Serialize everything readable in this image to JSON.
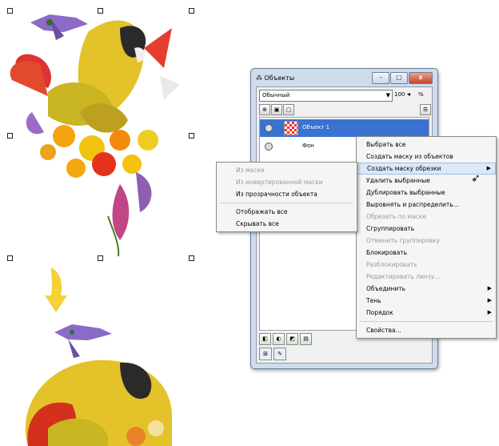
{
  "window": {
    "title": "Объекты",
    "controls": [
      "–",
      "□",
      "x"
    ],
    "blend_mode": "Обычный",
    "opacity": "100",
    "opacity_unit": "%",
    "layers": [
      {
        "label": "Объект 1",
        "selected": true
      },
      {
        "label": "Фон",
        "selected": false
      }
    ]
  },
  "context_menu": {
    "items": [
      {
        "label": "Выбрать все",
        "enabled": true
      },
      {
        "label": "Создать маску из объектов",
        "enabled": true
      },
      {
        "label": "Создать маску обрезки",
        "enabled": true,
        "submenu": true,
        "highlighted": true
      },
      {
        "label": "Удалить выбранные",
        "enabled": true
      },
      {
        "label": "Дублировать выбранные",
        "enabled": true
      },
      {
        "label": "Выровнять и распределить...",
        "enabled": true
      },
      {
        "label": "Обрезать по маске",
        "enabled": false
      },
      {
        "label": "Сгруппировать",
        "enabled": true
      },
      {
        "label": "Отменить группировку",
        "enabled": false
      },
      {
        "label": "Блокировать",
        "enabled": true
      },
      {
        "label": "Разблокировать",
        "enabled": false
      },
      {
        "label": "Редактировать линзу...",
        "enabled": false
      },
      {
        "label": "Объединить",
        "enabled": true,
        "submenu": true
      },
      {
        "label": "Тень",
        "enabled": true,
        "submenu": true
      },
      {
        "label": "Порядок",
        "enabled": true,
        "submenu": true
      },
      {
        "label": "Свойства...",
        "enabled": true
      }
    ]
  },
  "submenu": {
    "items": [
      {
        "label": "Из маски",
        "enabled": false
      },
      {
        "label": "Из инвертированной маски",
        "enabled": false
      },
      {
        "label": "Из прозрачности объекта",
        "enabled": true
      },
      {
        "label": "Отображать все",
        "enabled": true
      },
      {
        "label": "Скрывать все",
        "enabled": true
      }
    ]
  },
  "colors": {
    "selection": "#3a72d2",
    "arrow": "#f3d238"
  }
}
